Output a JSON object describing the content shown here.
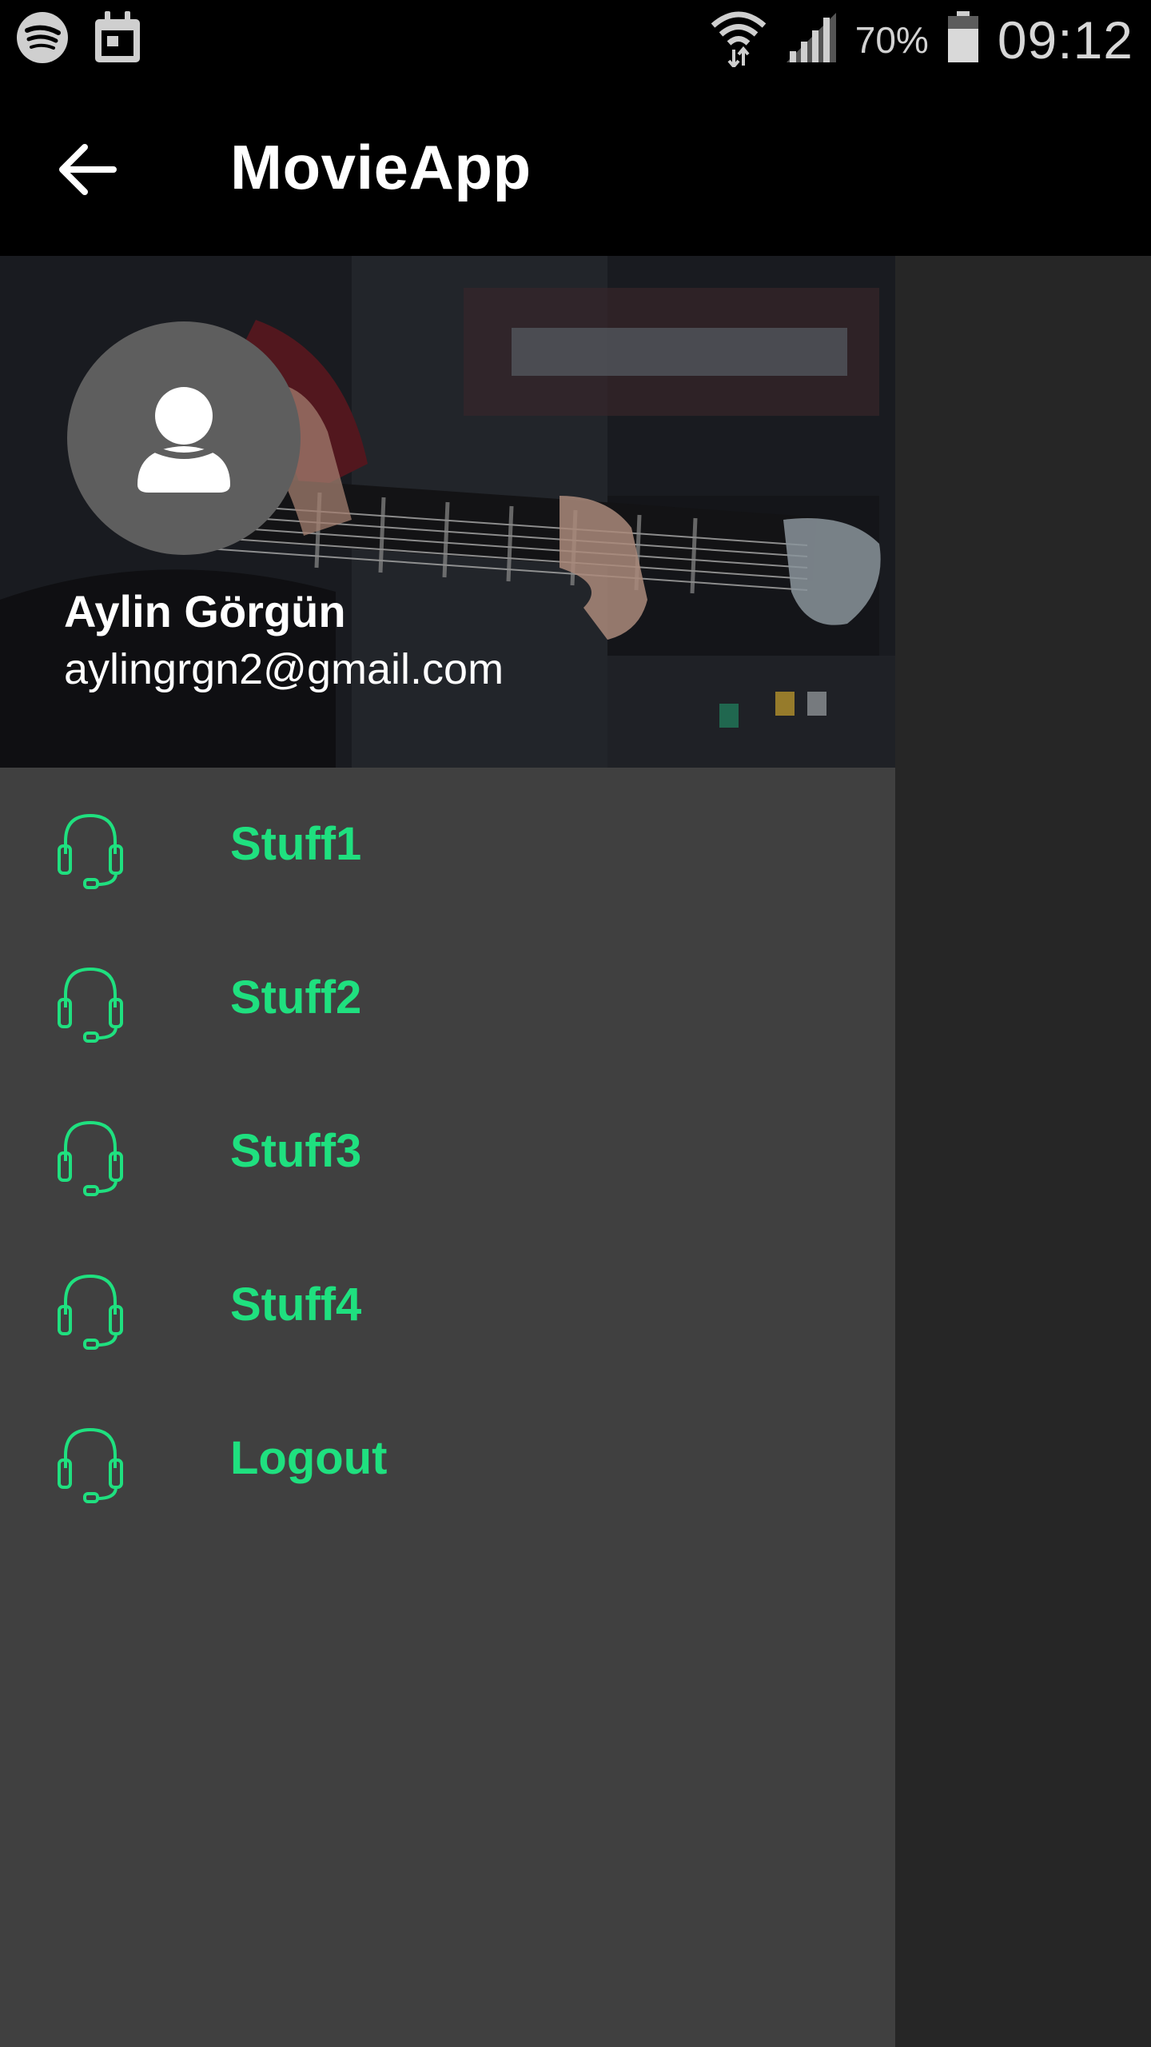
{
  "status_bar": {
    "battery": "70%",
    "time": "09:12",
    "icons": [
      "spotify-icon",
      "calendar-icon",
      "wifi-icon",
      "signal-icon",
      "battery-icon"
    ]
  },
  "app_bar": {
    "title": "MovieApp",
    "back_icon": "arrow-back-icon"
  },
  "drawer": {
    "header": {
      "name": "Aylin Görgün",
      "email": "aylingrgn2@gmail.com",
      "avatar_icon": "person-icon",
      "background": "guitar-photo"
    },
    "items": [
      {
        "label": "Stuff1",
        "icon": "headset-icon"
      },
      {
        "label": "Stuff2",
        "icon": "headset-icon"
      },
      {
        "label": "Stuff3",
        "icon": "headset-icon"
      },
      {
        "label": "Stuff4",
        "icon": "headset-icon"
      },
      {
        "label": "Logout",
        "icon": "headset-icon"
      }
    ]
  },
  "colors": {
    "accent": "#1fe07f",
    "drawer_bg": "#404040",
    "scrim": "#262626",
    "app_bar": "#000000"
  }
}
